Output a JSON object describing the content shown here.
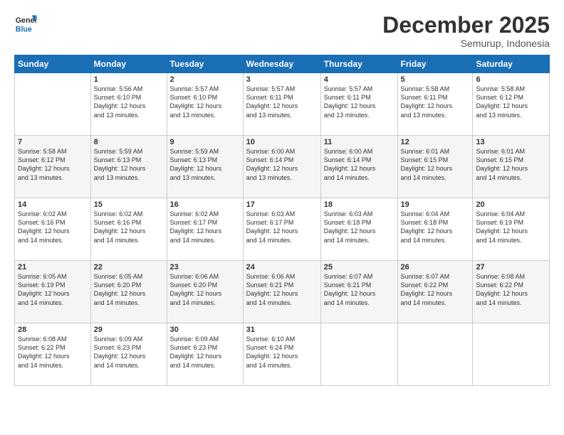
{
  "header": {
    "logo_line1": "General",
    "logo_line2": "Blue",
    "month": "December 2025",
    "location": "Semurup, Indonesia"
  },
  "weekdays": [
    "Sunday",
    "Monday",
    "Tuesday",
    "Wednesday",
    "Thursday",
    "Friday",
    "Saturday"
  ],
  "weeks": [
    [
      {
        "day": "",
        "text": ""
      },
      {
        "day": "1",
        "text": "Sunrise: 5:56 AM\nSunset: 6:10 PM\nDaylight: 12 hours\nand 13 minutes."
      },
      {
        "day": "2",
        "text": "Sunrise: 5:57 AM\nSunset: 6:10 PM\nDaylight: 12 hours\nand 13 minutes."
      },
      {
        "day": "3",
        "text": "Sunrise: 5:57 AM\nSunset: 6:11 PM\nDaylight: 12 hours\nand 13 minutes."
      },
      {
        "day": "4",
        "text": "Sunrise: 5:57 AM\nSunset: 6:11 PM\nDaylight: 12 hours\nand 13 minutes."
      },
      {
        "day": "5",
        "text": "Sunrise: 5:58 AM\nSunset: 6:11 PM\nDaylight: 12 hours\nand 13 minutes."
      },
      {
        "day": "6",
        "text": "Sunrise: 5:58 AM\nSunset: 6:12 PM\nDaylight: 12 hours\nand 13 minutes."
      }
    ],
    [
      {
        "day": "7",
        "text": "Sunrise: 5:58 AM\nSunset: 6:12 PM\nDaylight: 12 hours\nand 13 minutes."
      },
      {
        "day": "8",
        "text": "Sunrise: 5:59 AM\nSunset: 6:13 PM\nDaylight: 12 hours\nand 13 minutes."
      },
      {
        "day": "9",
        "text": "Sunrise: 5:59 AM\nSunset: 6:13 PM\nDaylight: 12 hours\nand 13 minutes."
      },
      {
        "day": "10",
        "text": "Sunrise: 6:00 AM\nSunset: 6:14 PM\nDaylight: 12 hours\nand 13 minutes."
      },
      {
        "day": "11",
        "text": "Sunrise: 6:00 AM\nSunset: 6:14 PM\nDaylight: 12 hours\nand 14 minutes."
      },
      {
        "day": "12",
        "text": "Sunrise: 6:01 AM\nSunset: 6:15 PM\nDaylight: 12 hours\nand 14 minutes."
      },
      {
        "day": "13",
        "text": "Sunrise: 6:01 AM\nSunset: 6:15 PM\nDaylight: 12 hours\nand 14 minutes."
      }
    ],
    [
      {
        "day": "14",
        "text": "Sunrise: 6:02 AM\nSunset: 6:16 PM\nDaylight: 12 hours\nand 14 minutes."
      },
      {
        "day": "15",
        "text": "Sunrise: 6:02 AM\nSunset: 6:16 PM\nDaylight: 12 hours\nand 14 minutes."
      },
      {
        "day": "16",
        "text": "Sunrise: 6:02 AM\nSunset: 6:17 PM\nDaylight: 12 hours\nand 14 minutes."
      },
      {
        "day": "17",
        "text": "Sunrise: 6:03 AM\nSunset: 6:17 PM\nDaylight: 12 hours\nand 14 minutes."
      },
      {
        "day": "18",
        "text": "Sunrise: 6:03 AM\nSunset: 6:18 PM\nDaylight: 12 hours\nand 14 minutes."
      },
      {
        "day": "19",
        "text": "Sunrise: 6:04 AM\nSunset: 6:18 PM\nDaylight: 12 hours\nand 14 minutes."
      },
      {
        "day": "20",
        "text": "Sunrise: 6:04 AM\nSunset: 6:19 PM\nDaylight: 12 hours\nand 14 minutes."
      }
    ],
    [
      {
        "day": "21",
        "text": "Sunrise: 6:05 AM\nSunset: 6:19 PM\nDaylight: 12 hours\nand 14 minutes."
      },
      {
        "day": "22",
        "text": "Sunrise: 6:05 AM\nSunset: 6:20 PM\nDaylight: 12 hours\nand 14 minutes."
      },
      {
        "day": "23",
        "text": "Sunrise: 6:06 AM\nSunset: 6:20 PM\nDaylight: 12 hours\nand 14 minutes."
      },
      {
        "day": "24",
        "text": "Sunrise: 6:06 AM\nSunset: 6:21 PM\nDaylight: 12 hours\nand 14 minutes."
      },
      {
        "day": "25",
        "text": "Sunrise: 6:07 AM\nSunset: 6:21 PM\nDaylight: 12 hours\nand 14 minutes."
      },
      {
        "day": "26",
        "text": "Sunrise: 6:07 AM\nSunset: 6:22 PM\nDaylight: 12 hours\nand 14 minutes."
      },
      {
        "day": "27",
        "text": "Sunrise: 6:08 AM\nSunset: 6:22 PM\nDaylight: 12 hours\nand 14 minutes."
      }
    ],
    [
      {
        "day": "28",
        "text": "Sunrise: 6:08 AM\nSunset: 6:22 PM\nDaylight: 12 hours\nand 14 minutes."
      },
      {
        "day": "29",
        "text": "Sunrise: 6:09 AM\nSunset: 6:23 PM\nDaylight: 12 hours\nand 14 minutes."
      },
      {
        "day": "30",
        "text": "Sunrise: 6:09 AM\nSunset: 6:23 PM\nDaylight: 12 hours\nand 14 minutes."
      },
      {
        "day": "31",
        "text": "Sunrise: 6:10 AM\nSunset: 6:24 PM\nDaylight: 12 hours\nand 14 minutes."
      },
      {
        "day": "",
        "text": ""
      },
      {
        "day": "",
        "text": ""
      },
      {
        "day": "",
        "text": ""
      }
    ]
  ]
}
